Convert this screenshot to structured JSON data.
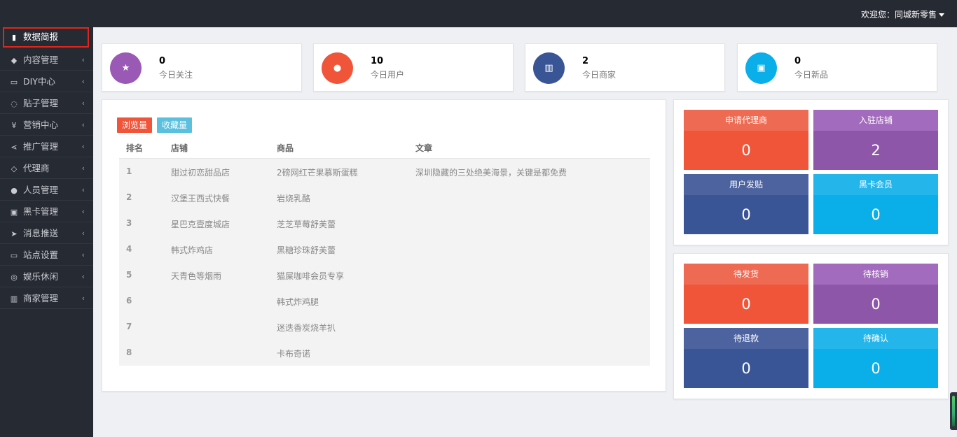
{
  "header": {
    "welcome": "欢迎您：同城新零售"
  },
  "sidebar": {
    "items": [
      {
        "icon": "bar-chart-icon",
        "glyph": "▮",
        "label": "数据简报"
      },
      {
        "icon": "tags-icon",
        "glyph": "◆",
        "label": "内容管理"
      },
      {
        "icon": "monitor-icon",
        "glyph": "▭",
        "label": "DIY中心"
      },
      {
        "icon": "comment-icon",
        "glyph": "◌",
        "label": "贴子管理"
      },
      {
        "icon": "yen-icon",
        "glyph": "¥",
        "label": "营销中心"
      },
      {
        "icon": "share-icon",
        "glyph": "⋖",
        "label": "推广管理"
      },
      {
        "icon": "diamond-icon",
        "glyph": "◇",
        "label": "代理商"
      },
      {
        "icon": "users-icon",
        "glyph": "●",
        "label": "人员管理"
      },
      {
        "icon": "id-card-icon",
        "glyph": "▣",
        "label": "黑卡管理"
      },
      {
        "icon": "paper-plane-icon",
        "glyph": "➤",
        "label": "消息推送"
      },
      {
        "icon": "desktop-icon",
        "glyph": "▭",
        "label": "站点设置"
      },
      {
        "icon": "gamepad-icon",
        "glyph": "◎",
        "label": "娱乐休闲"
      },
      {
        "icon": "bank-icon",
        "glyph": "▥",
        "label": "商家管理"
      }
    ],
    "chevron": "‹"
  },
  "stats": [
    {
      "icon": "star-icon",
      "glyph": "★",
      "color": "#9b59b6",
      "value": "0",
      "label": "今日关注"
    },
    {
      "icon": "users-icon",
      "glyph": "●",
      "color": "#f0553a",
      "value": "10",
      "label": "今日用户"
    },
    {
      "icon": "bank-icon",
      "glyph": "▥",
      "color": "#3a5596",
      "value": "2",
      "label": "今日商家"
    },
    {
      "icon": "shopping-bag-icon",
      "glyph": "▣",
      "color": "#0aaee8",
      "value": "0",
      "label": "今日新品"
    }
  ],
  "ranking": {
    "tabs": [
      {
        "label": "浏览量",
        "color": "#f0553a"
      },
      {
        "label": "收藏量",
        "color": "#5bc0de"
      }
    ],
    "columns": [
      "排名",
      "店铺",
      "商品",
      "文章"
    ],
    "rows": [
      [
        "1",
        "甜过初恋甜品店",
        "2磅网红芒果慕斯蛋糕",
        "深圳隐藏的三处绝美海景，关键是都免费"
      ],
      [
        "2",
        "汉堡王西式快餐",
        "岩烧乳酪",
        ""
      ],
      [
        "3",
        "星巴克壹度城店",
        "芝芝草莓舒芙蕾",
        ""
      ],
      [
        "4",
        "韩式炸鸡店",
        "黑糖珍珠舒芙蕾",
        ""
      ],
      [
        "5",
        "天青色等烟雨",
        "猫屎咖啡会员专享",
        ""
      ],
      [
        "6",
        "",
        "韩式炸鸡腿",
        ""
      ],
      [
        "7",
        "",
        "迷迭香炭烧羊扒",
        ""
      ],
      [
        "8",
        "",
        "卡布奇诺",
        ""
      ]
    ]
  },
  "summary_a": [
    {
      "title": "申请代理商",
      "value": "0",
      "style": "t-red"
    },
    {
      "title": "入驻店铺",
      "value": "2",
      "style": "t-purple"
    },
    {
      "title": "用户发贴",
      "value": "0",
      "style": "t-navy"
    },
    {
      "title": "黑卡会员",
      "value": "0",
      "style": "t-cyan"
    }
  ],
  "summary_b": [
    {
      "title": "待发货",
      "value": "0",
      "style": "t-red"
    },
    {
      "title": "待核销",
      "value": "0",
      "style": "t-purple"
    },
    {
      "title": "待退款",
      "value": "0",
      "style": "t-navy"
    },
    {
      "title": "待确认",
      "value": "0",
      "style": "t-cyan"
    }
  ]
}
